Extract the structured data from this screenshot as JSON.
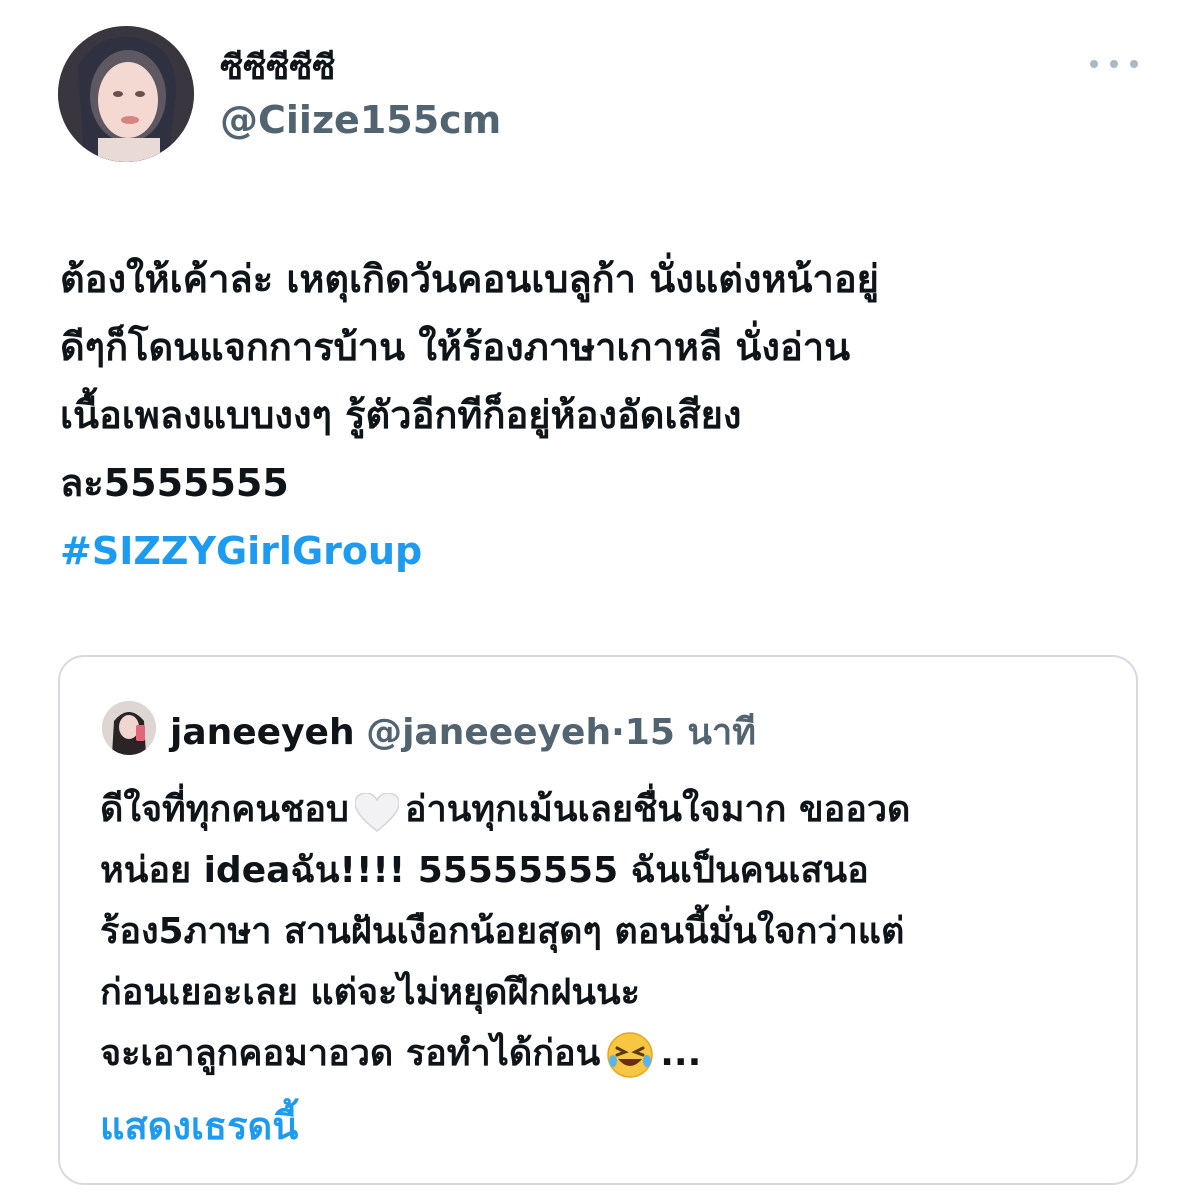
{
  "author": {
    "display_name": "ซีซีซีซีซี",
    "handle": "@Ciize155cm"
  },
  "tweet": {
    "lines": [
      "ต้องให้เค้าล่ะ เหตุเกิดวันคอนเบลูก้า นั่งแต่งหน้าอยู่",
      "ดีๆก็โดนแจกการบ้าน ให้ร้องภาษาเกาหลี นั่งอ่าน",
      "เนื้อเพลงแบบงงๆ รู้ตัวอีกทีก็อยู่ห้องอัดเสียง",
      "ละ5555555"
    ],
    "hashtag": "#SIZZYGirlGroup"
  },
  "quoted_tweet": {
    "name": "janeeyeh",
    "handle": "@janeeeyeh",
    "separator": "·",
    "time": "15 นาที",
    "line1_a": "ดีใจที่ทุกคนชอบ",
    "line1_b": "อ่านทุกเม้นเลยชื่นใจมาก ขออวด",
    "line2": "หน่อย ideaฉัน!!!! 55555555 ฉันเป็นคนเสนอ",
    "line3": "ร้อง5ภาษา สานฝันเงือกน้อยสุดๆ ตอนนี้มั่นใจกว่าแต่",
    "line4": "ก่อนเยอะเลย แต่จะไม่หยุดฝึกฝนนะ",
    "line5_a": "จะเอาลูกคอมาอวด รอทำได้ก่อน",
    "line5_b": "...",
    "show_thread": "แสดงเธรดนี้"
  },
  "icons": {
    "more": "more-horizontal-icon",
    "heart": "white-heart-emoji",
    "laugh": "rolling-on-floor-laughing-emoji"
  },
  "colors": {
    "link": "#1d9bf0",
    "secondary_text": "#536471",
    "border": "#d4dadf"
  }
}
